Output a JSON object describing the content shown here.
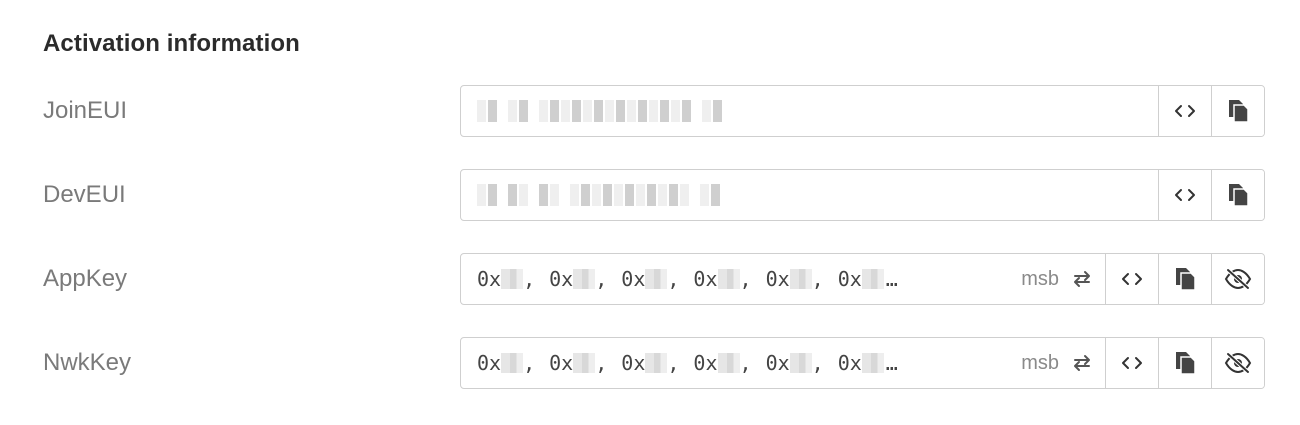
{
  "section": {
    "title": "Activation information"
  },
  "fields": {
    "join_eui": {
      "label": "JoinEUI"
    },
    "dev_eui": {
      "label": "DevEUI"
    },
    "app_key": {
      "label": "AppKey",
      "byte_prefix": "0x",
      "separator": ",",
      "ellipsis": "…",
      "byte_order": "msb"
    },
    "nwk_key": {
      "label": "NwkKey",
      "byte_prefix": "0x",
      "separator": ",",
      "ellipsis": "…",
      "byte_order": "msb"
    }
  },
  "icons": {
    "format_toggle": "code-brackets-icon",
    "copy": "copy-icon",
    "visibility": "eye-off-icon",
    "byte_order_toggle": "swap-arrows-icon"
  },
  "colors": {
    "label": "#7a7a7a",
    "title": "#2b2b2b",
    "border": "#cfcfcf"
  }
}
